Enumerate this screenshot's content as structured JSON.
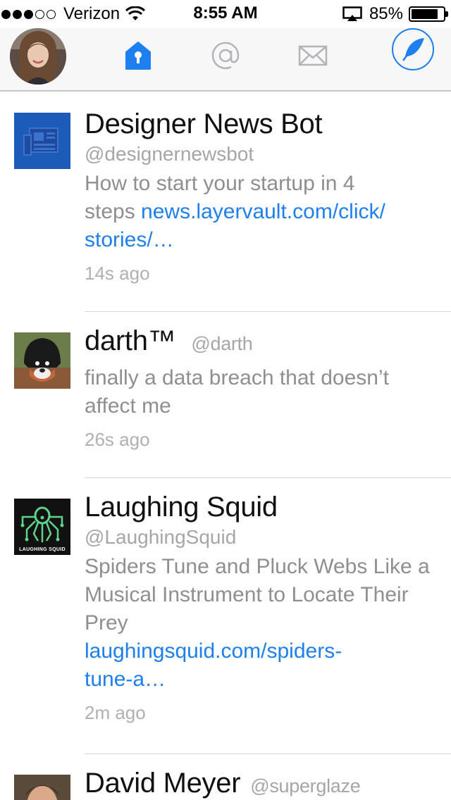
{
  "status_bar": {
    "carrier": "Verizon",
    "time": "8:55 AM",
    "battery_percent": "85%",
    "battery_level": 0.85,
    "signal_bars_filled": 3,
    "signal_bars_total": 5
  },
  "nav": {
    "icons": [
      "home-icon",
      "at-mentions-icon",
      "envelope-messages-icon",
      "quill-compose-icon"
    ],
    "active_color": "#1d7ff0",
    "inactive_color": "#b4b4b8"
  },
  "tweets": [
    {
      "name": "Designer News Bot",
      "handle": "@designernewsbot",
      "text_line1": "How to start your startup in 4",
      "text_line2_plain": "steps ",
      "text_link_part1": "news.layervault.com/click/",
      "text_link_part2": "stories/…",
      "time": "14s ago"
    },
    {
      "name": "darth™",
      "handle": "@darth",
      "text": "finally a data breach that doesn’t affect me",
      "time": "26s ago"
    },
    {
      "name": "Laughing Squid",
      "handle": "@LaughingSquid",
      "avatar_caption": "LAUGHING SQUID",
      "text": "Spiders Tune and Pluck Webs Like a Musical Instrument to Locate Their Prey",
      "link_part1": "laughingsquid.com/spiders-",
      "link_part2": "tune-a…",
      "time": "2m ago"
    },
    {
      "name": "David Meyer",
      "handle": "@superglaze"
    }
  ]
}
